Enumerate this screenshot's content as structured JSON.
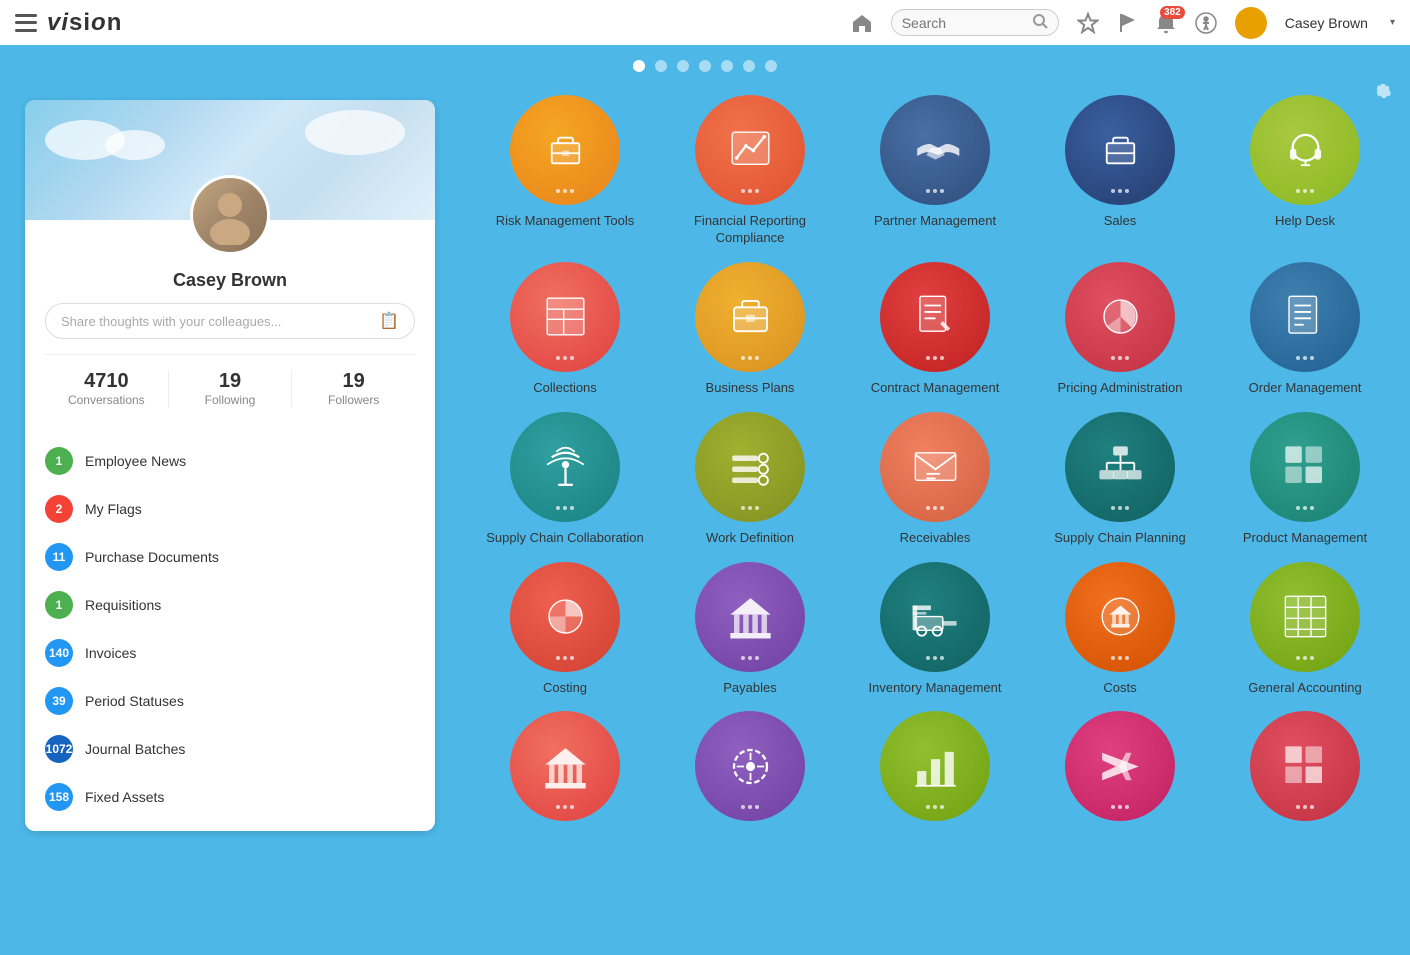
{
  "app": {
    "name": "vision",
    "title": "VISION"
  },
  "header": {
    "search_placeholder": "Search",
    "notification_count": "382",
    "user_name": "Casey Brown",
    "home_icon": "home-icon",
    "star_icon": "star-icon",
    "flag_icon": "flag-icon",
    "bell_icon": "bell-icon",
    "accessibility_icon": "accessibility-icon",
    "avatar_icon": "avatar-icon",
    "dropdown_arrow": "▾"
  },
  "page_dots": {
    "active_index": 0,
    "count": 7
  },
  "profile": {
    "name": "Casey Brown",
    "thoughts_placeholder": "Share thoughts with your colleagues...",
    "conversations": "4710",
    "conversations_label": "Conversations",
    "following": "19",
    "following_label": "Following",
    "followers": "19",
    "followers_label": "Followers"
  },
  "nav_items": [
    {
      "id": "employee-news",
      "label": "Employee News",
      "count": "1",
      "color": "#4caf50"
    },
    {
      "id": "my-flags",
      "label": "My Flags",
      "count": "2",
      "color": "#f44336"
    },
    {
      "id": "purchase-documents",
      "label": "Purchase Documents",
      "count": "11",
      "color": "#2196f3"
    },
    {
      "id": "requisitions",
      "label": "Requisitions",
      "count": "1",
      "color": "#4caf50"
    },
    {
      "id": "invoices",
      "label": "Invoices",
      "count": "140",
      "color": "#2196f3"
    },
    {
      "id": "period-statuses",
      "label": "Period Statuses",
      "count": "39",
      "color": "#2196f3"
    },
    {
      "id": "journal-batches",
      "label": "Journal Batches",
      "count": "1072",
      "color": "#1565c0"
    },
    {
      "id": "fixed-assets",
      "label": "Fixed Assets",
      "count": "158",
      "color": "#2196f3"
    }
  ],
  "apps": [
    {
      "id": "risk-management",
      "label": "Risk Management Tools",
      "color_class": "color-orange",
      "icon": "briefcase"
    },
    {
      "id": "financial-reporting",
      "label": "Financial Reporting Compliance",
      "color_class": "color-red-orange",
      "icon": "chart-up"
    },
    {
      "id": "partner-management",
      "label": "Partner Management",
      "color_class": "color-navy",
      "icon": "handshake"
    },
    {
      "id": "sales",
      "label": "Sales",
      "color_class": "color-blue-dark",
      "icon": "briefcase2"
    },
    {
      "id": "help-desk",
      "label": "Help Desk",
      "color_class": "color-yellow-green",
      "icon": "headset"
    },
    {
      "id": "collections",
      "label": "Collections",
      "color_class": "color-coral",
      "icon": "grid-table"
    },
    {
      "id": "business-plans",
      "label": "Business Plans",
      "color_class": "color-gold",
      "icon": "briefcase3"
    },
    {
      "id": "contract-management",
      "label": "Contract Management",
      "color_class": "color-red-deep",
      "icon": "document-lines"
    },
    {
      "id": "pricing-administration",
      "label": "Pricing Administration",
      "color_class": "color-pink-red",
      "icon": "pie-chart"
    },
    {
      "id": "order-management",
      "label": "Order Management",
      "color_class": "color-steel-blue",
      "icon": "document-list"
    },
    {
      "id": "supply-chain-collaboration",
      "label": "Supply Chain Collaboration",
      "color_class": "color-teal",
      "icon": "signal-tower"
    },
    {
      "id": "work-definition",
      "label": "Work Definition",
      "color_class": "color-olive",
      "icon": "settings-cog"
    },
    {
      "id": "receivables",
      "label": "Receivables",
      "color_class": "color-salmon",
      "icon": "envelope-lines"
    },
    {
      "id": "supply-chain-planning",
      "label": "Supply Chain Planning",
      "color_class": "color-teal-dark",
      "icon": "org-chart"
    },
    {
      "id": "product-management",
      "label": "Product Management",
      "color_class": "color-teal-med",
      "icon": "blocks"
    },
    {
      "id": "costing",
      "label": "Costing",
      "color_class": "color-coral2",
      "icon": "pie-chart2"
    },
    {
      "id": "payables",
      "label": "Payables",
      "color_class": "color-purple",
      "icon": "bank-building"
    },
    {
      "id": "inventory-management",
      "label": "Inventory Management",
      "color_class": "color-teal-dark",
      "icon": "forklift"
    },
    {
      "id": "costs",
      "label": "Costs",
      "color_class": "color-orange-warm",
      "icon": "bank-circle"
    },
    {
      "id": "general-accounting",
      "label": "General Accounting",
      "color_class": "color-lime",
      "icon": "grid-spreadsheet"
    },
    {
      "id": "app-21",
      "label": "",
      "color_class": "color-coral",
      "icon": "bank-building2"
    },
    {
      "id": "app-22",
      "label": "",
      "color_class": "color-purple",
      "icon": "cycle"
    },
    {
      "id": "app-23",
      "label": "",
      "color_class": "color-lime",
      "icon": "chart-bar"
    },
    {
      "id": "app-24",
      "label": "",
      "color_class": "color-pink",
      "icon": "plane"
    },
    {
      "id": "app-25",
      "label": "",
      "color_class": "color-pink-red",
      "icon": "grid4"
    }
  ]
}
